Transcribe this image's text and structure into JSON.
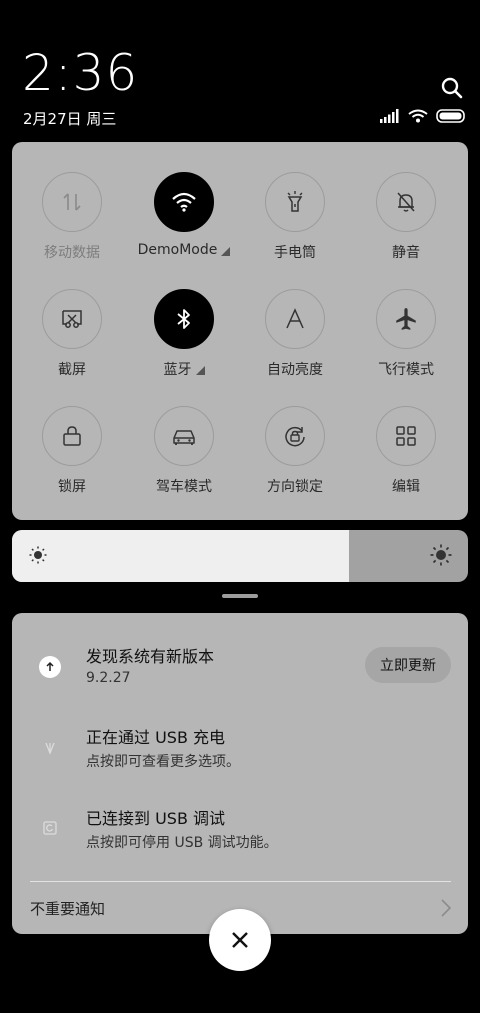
{
  "status": {
    "time": "2:36",
    "date": "2月27日 周三"
  },
  "quick_settings": {
    "tiles": [
      {
        "label": "移动数据",
        "icon": "mobile-data-icon",
        "active": false,
        "dim": true
      },
      {
        "label": "DemoMode",
        "icon": "wifi-icon",
        "active": true,
        "has_menu": true
      },
      {
        "label": "手电筒",
        "icon": "flashlight-icon",
        "active": false
      },
      {
        "label": "静音",
        "icon": "bell-off-icon",
        "active": false
      },
      {
        "label": "截屏",
        "icon": "screenshot-icon",
        "active": false
      },
      {
        "label": "蓝牙",
        "icon": "bluetooth-icon",
        "active": true,
        "has_menu": true
      },
      {
        "label": "自动亮度",
        "icon": "auto-brightness-icon",
        "active": false
      },
      {
        "label": "飞行模式",
        "icon": "airplane-icon",
        "active": false
      },
      {
        "label": "锁屏",
        "icon": "lock-icon",
        "active": false
      },
      {
        "label": "驾车模式",
        "icon": "car-icon",
        "active": false
      },
      {
        "label": "方向锁定",
        "icon": "rotation-lock-icon",
        "active": false
      },
      {
        "label": "编辑",
        "icon": "grid-edit-icon",
        "active": false
      }
    ]
  },
  "brightness": {
    "level": 0.74
  },
  "notifications": {
    "items": [
      {
        "title": "发现系统有新版本",
        "text": "9.2.27",
        "icon": "upload-arrow-icon",
        "action": "立即更新"
      },
      {
        "title": "正在通过 USB 充电",
        "text": "点按即可查看更多选项。",
        "icon": "usb-icon"
      },
      {
        "title": "已连接到 USB 调试",
        "text": "点按即可停用 USB 调试功能。",
        "icon": "debug-icon"
      }
    ],
    "footer_label": "不重要通知"
  },
  "colors": {
    "panel": "#b6b6b6",
    "active_tile": "#000000",
    "background": "#000000"
  }
}
